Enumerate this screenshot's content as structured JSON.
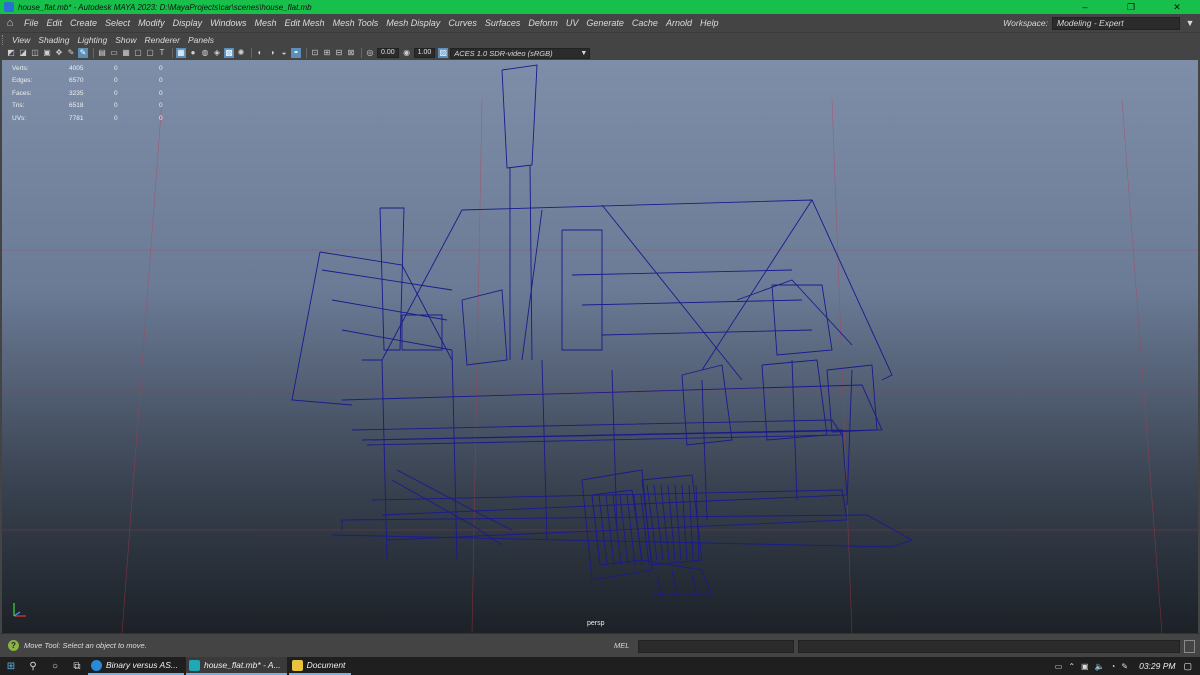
{
  "window": {
    "title": "house_flat.mb* - Autodesk MAYA 2023: D:\\MayaProjects\\car\\scenes\\house_flat.mb",
    "controls": [
      "–",
      "❐",
      "✕"
    ]
  },
  "menubar": {
    "items": [
      "File",
      "Edit",
      "Create",
      "Select",
      "Modify",
      "Display",
      "Windows",
      "Mesh",
      "Edit Mesh",
      "Mesh Tools",
      "Mesh Display",
      "Curves",
      "Surfaces",
      "Deform",
      "UV",
      "Generate",
      "Cache",
      "Arnold",
      "Help"
    ],
    "workspace_label": "Workspace:",
    "workspace_value": "Modeling - Expert"
  },
  "panel_menu": {
    "items": [
      "View",
      "Shading",
      "Lighting",
      "Show",
      "Renderer",
      "Panels"
    ]
  },
  "panel_toolbar": {
    "field_a": "0.00",
    "field_b": "1.00",
    "colorspace": "ACES 1.0 SDR-video (sRGB)"
  },
  "hud": {
    "rows": [
      {
        "label": "Verts:",
        "a": "4005",
        "b": "0",
        "c": "0"
      },
      {
        "label": "Edges:",
        "a": "6570",
        "b": "0",
        "c": "0"
      },
      {
        "label": "Faces:",
        "a": "3235",
        "b": "0",
        "c": "0"
      },
      {
        "label": "Tris:",
        "a": "6518",
        "b": "0",
        "c": "0"
      },
      {
        "label": "UVs:",
        "a": "7781",
        "b": "0",
        "c": "0"
      }
    ]
  },
  "viewport": {
    "camera": "persp",
    "wire_color": "#1a1a8c"
  },
  "helpline": {
    "message": "Move Tool: Select an object to move.",
    "mel_label": "MEL"
  },
  "taskbar": {
    "tasks": [
      {
        "label": "Binary versus AS...",
        "active": false
      },
      {
        "label": "house_flat.mb* - A...",
        "active": true
      },
      {
        "label": "Document",
        "active": false
      }
    ],
    "clock": "03:29 PM"
  }
}
